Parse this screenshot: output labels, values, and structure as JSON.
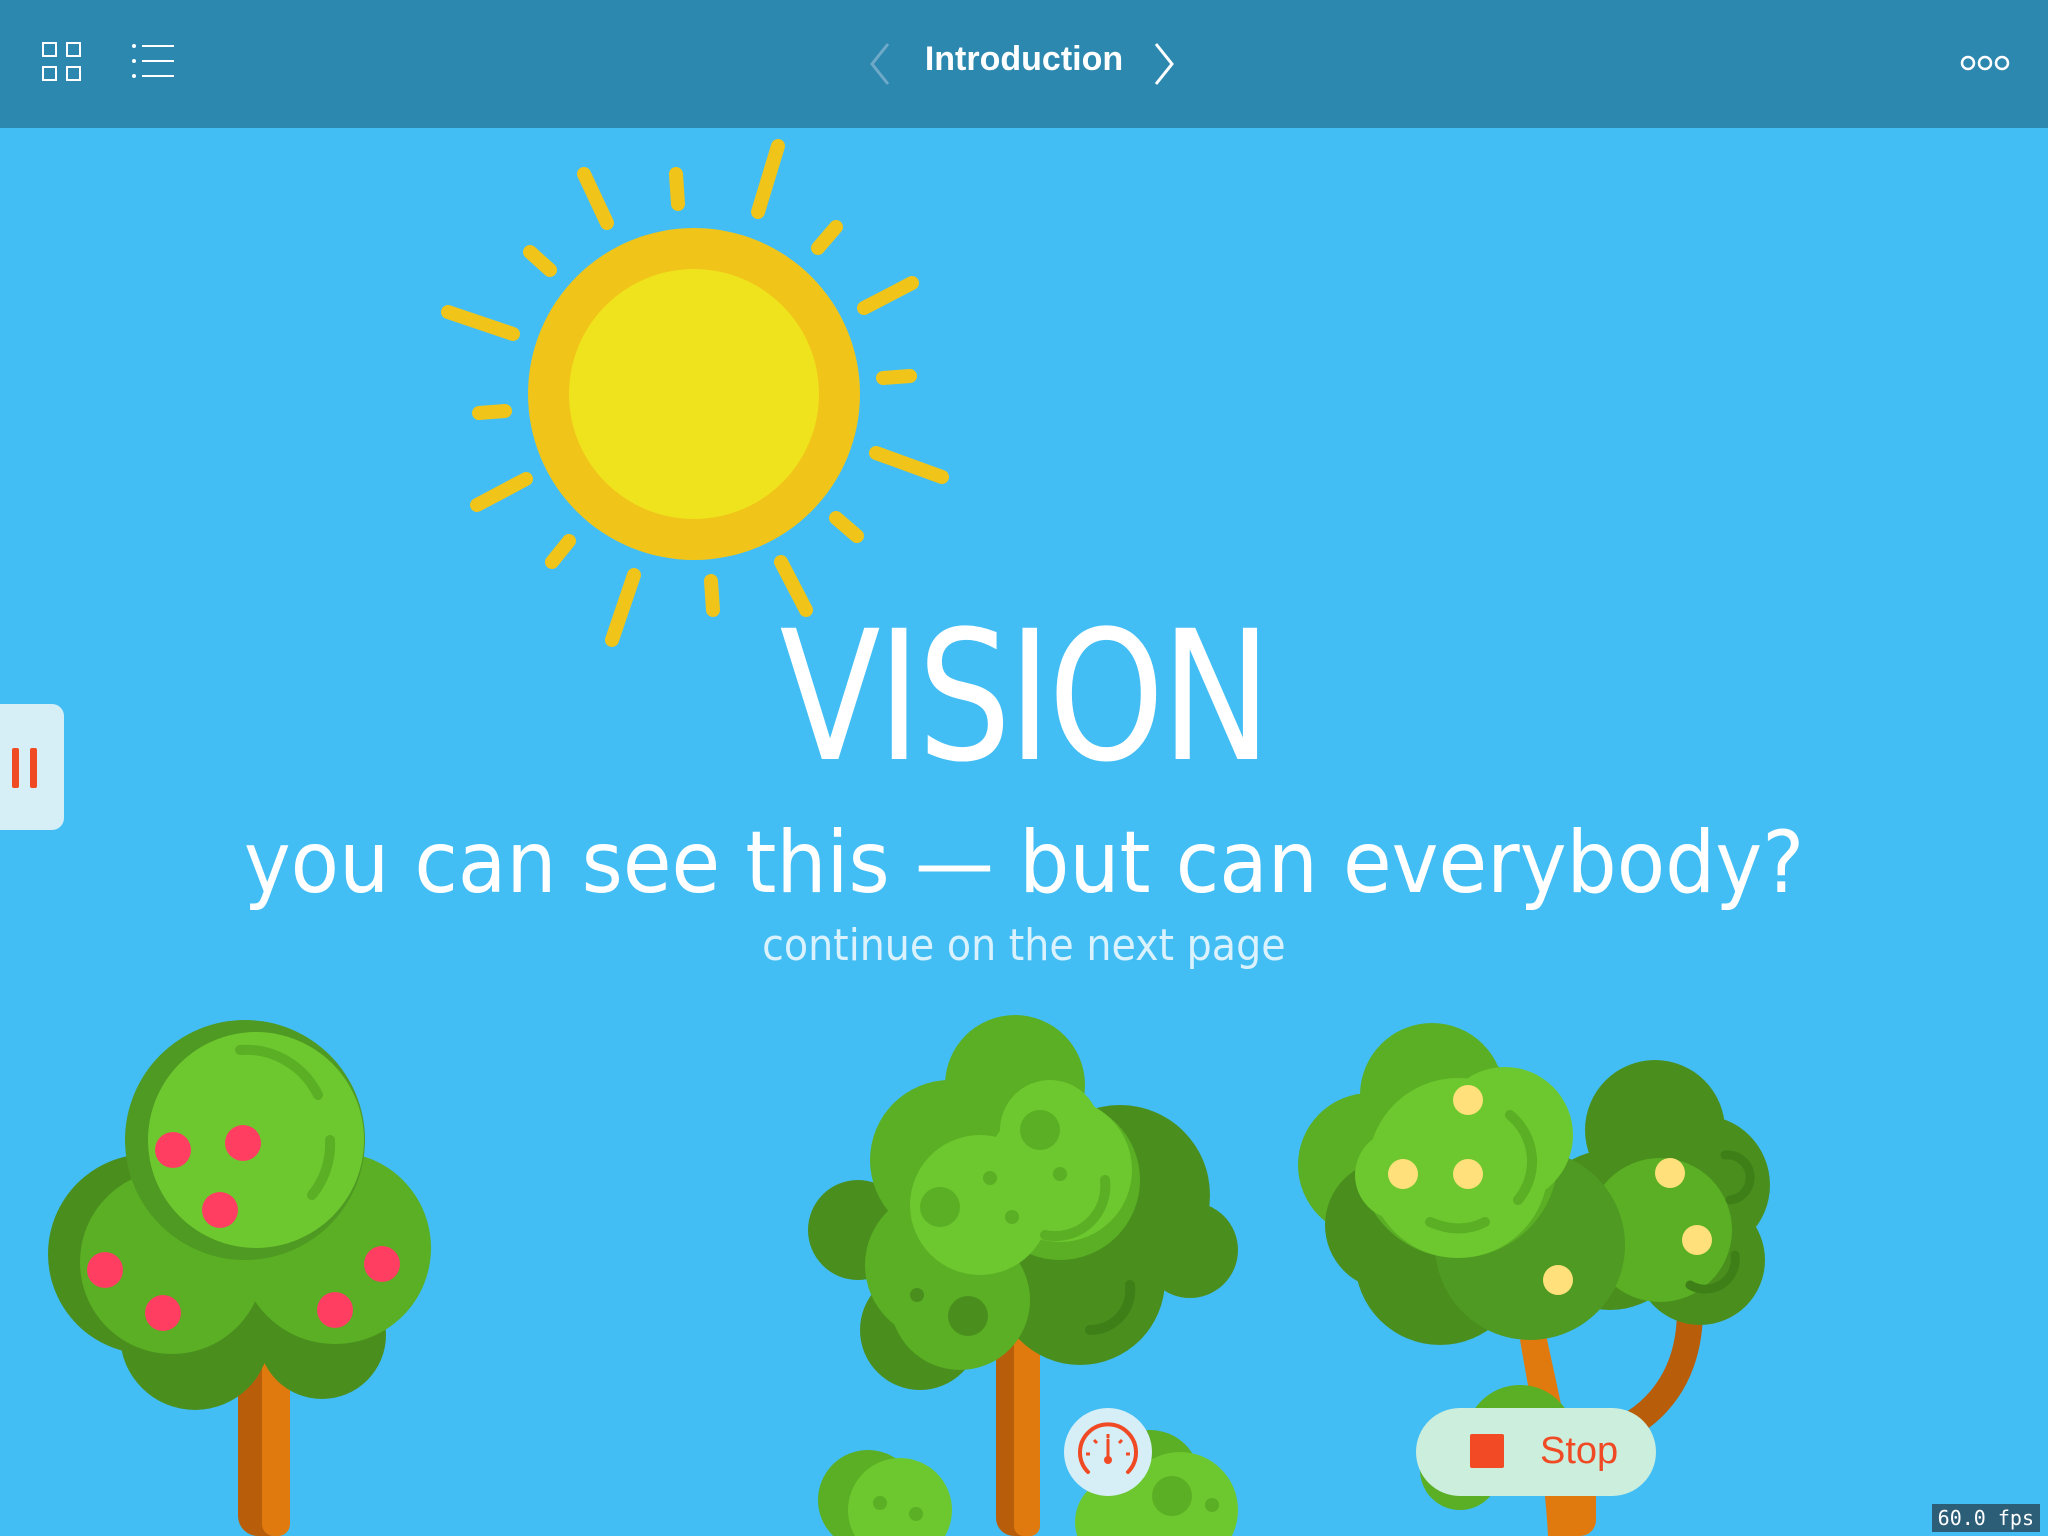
{
  "toolbar": {
    "title": "Introduction",
    "icons": [
      "grid-icon",
      "list-icon",
      "chevron-left-icon",
      "chevron-right-icon",
      "more-icon"
    ]
  },
  "slide": {
    "heading": "VISION",
    "subtitle": "you can see this — but can everybody?",
    "hint": "continue on the next page"
  },
  "controls": {
    "stop_label": "Stop",
    "fps": "60.0 fps"
  },
  "colors": {
    "toolbar": "#2d88b0",
    "background": "#43bef5",
    "sun_outer": "#f0c419",
    "sun_inner": "#efe31d",
    "leaf_light": "#6dc82f",
    "leaf_mid": "#5aaf24",
    "leaf_dark": "#4a8f1e",
    "trunk": "#e07a0e",
    "accent_red": "#f04a24",
    "fruit_red": "#ff3e62",
    "fruit_yellow": "#ffe07a"
  }
}
